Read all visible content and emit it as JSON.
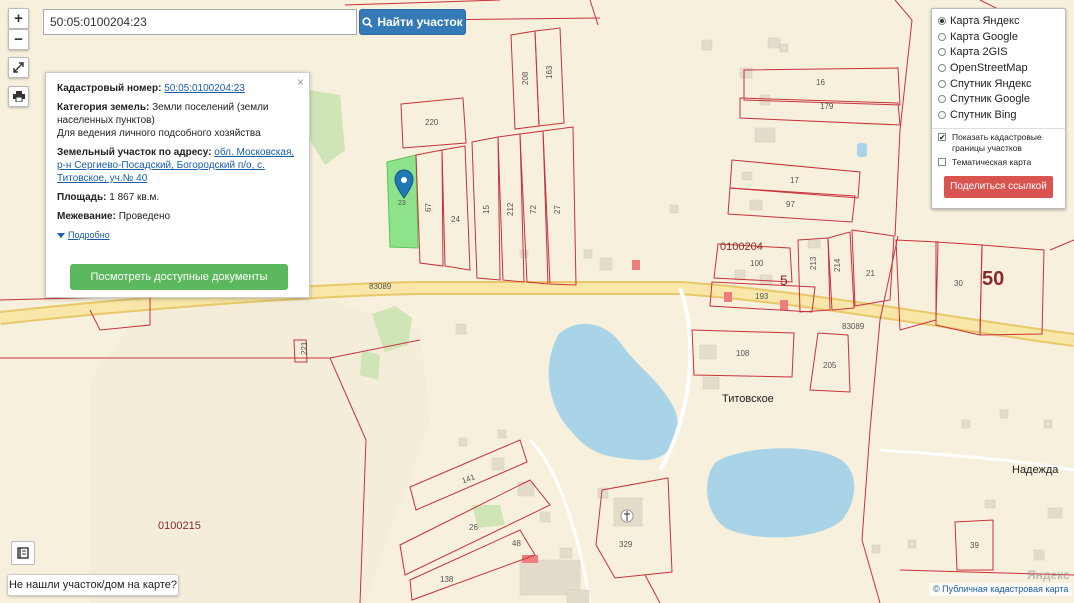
{
  "search": {
    "value": "50:05:0100204:23",
    "button_label": "Найти участок"
  },
  "zoom": {
    "in_label": "+",
    "out_label": "−"
  },
  "info": {
    "close_label": "×",
    "cad_label": "Кадастровый номер:",
    "cad_value": "50:05:0100204:23",
    "cat_label": "Категория земель:",
    "cat_value": "Земли поселений (земли населенных пунктов)",
    "use_value": "Для ведения личного подсобного хозяйства",
    "addr_label": "Земельный участок по адресу:",
    "addr_value": "обл. Московская, р-н Сергиево-Посадский, Богородский п/о, с. Титовское, уч.№ 40",
    "area_label": "Площадь:",
    "area_value": "1 867 кв.м.",
    "survey_label": "Межевание:",
    "survey_value": "Проведено",
    "detail_label": "Подробно",
    "docs_button": "Посмотреть доступные документы"
  },
  "layers": {
    "options": [
      {
        "label": "Карта Яндекс",
        "selected": true
      },
      {
        "label": "Карта Google",
        "selected": false
      },
      {
        "label": "Карта 2GIS",
        "selected": false
      },
      {
        "label": "OpenStreetMap",
        "selected": false
      },
      {
        "label": "Спутник Яндекс",
        "selected": false
      },
      {
        "label": "Спутник Google",
        "selected": false
      },
      {
        "label": "Спутник Bing",
        "selected": false
      }
    ],
    "show_cadastral": "Показать кадастровые границы участков",
    "thematic": "Тематическая карта",
    "share_button": "Поделиться ссылкой"
  },
  "not_found": "Не нашли участок/дом на карте?",
  "attribution": "© Публичная кадастровая карта",
  "watermark": "Яндекс",
  "map": {
    "road_label_1": "83089",
    "road_label_2": "83089",
    "quarter_1": "0100204",
    "quarter_2": "0100215",
    "district_5": "5",
    "district_50": "50",
    "village_1": "Титовское",
    "village_2": "Надежда",
    "parcels": [
      "220",
      "23",
      "67",
      "24",
      "15",
      "212",
      "72",
      "27",
      "208",
      "163",
      "16",
      "179",
      "17",
      "97",
      "100",
      "213",
      "214",
      "21",
      "193",
      "30",
      "108",
      "205",
      "141",
      "26",
      "48",
      "138",
      "329",
      "39",
      "221"
    ]
  },
  "colors": {
    "accent": "#337ab7",
    "green": "#5cb85c",
    "red": "#d9534f",
    "parcel_line": "#c8323c",
    "water": "#a9d3e6",
    "land": "#f7f0dc",
    "road": "#f7e29a",
    "selected_parcel": "#8ee38a"
  }
}
